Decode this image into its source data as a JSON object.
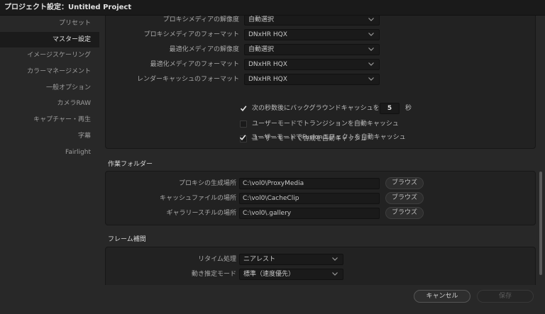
{
  "window": {
    "title": "プロジェクト設定：Untitled Project"
  },
  "sidebar": {
    "items": [
      {
        "label": "プリセット"
      },
      {
        "label": "マスター設定"
      },
      {
        "label": "イメージスケーリング"
      },
      {
        "label": "カラーマネージメント"
      },
      {
        "label": "一般オプション"
      },
      {
        "label": "カメラRAW"
      },
      {
        "label": "キャプチャー・再生"
      },
      {
        "label": "字幕"
      },
      {
        "label": "Fairlight"
      }
    ],
    "active_index": 1
  },
  "cache": {
    "rows": [
      {
        "label": "プロキシメディアの解像度",
        "value": "自動選択"
      },
      {
        "label": "プロキシメディアのフォーマット",
        "value": "DNxHR HQX"
      },
      {
        "label": "最適化メディアの解像度",
        "value": "自動選択"
      },
      {
        "label": "最適化メディアのフォーマット",
        "value": "DNxHR HQX"
      },
      {
        "label": "レンダーキャッシュのフォーマット",
        "value": "DNxHR HQX"
      }
    ],
    "bg_cache": {
      "label": "次の秒数後にバックグラウンドキャッシュを開始",
      "checked": true,
      "seconds": "5",
      "unit": "秒"
    },
    "options": [
      {
        "label": "ユーザーモードでトランジションを自動キャッシュ",
        "checked": false
      },
      {
        "label": "ユーザーモードで合成を自動キャッシュ",
        "checked": false
      },
      {
        "label": "ユーザーモードでFusionエフェクトを自動キャッシュ",
        "checked": true
      }
    ]
  },
  "working_folders": {
    "title": "作業フォルダー",
    "browse_label": "ブラウズ",
    "rows": [
      {
        "label": "プロキシの生成場所",
        "value": "C:\\vol0\\ProxyMedia"
      },
      {
        "label": "キャッシュファイルの場所",
        "value": "C:\\vol0\\CacheClip"
      },
      {
        "label": "ギャラリースチルの場所",
        "value": "C:\\vol0\\.gallery"
      }
    ]
  },
  "frame_interp": {
    "title": "フレーム補間",
    "rows": [
      {
        "label": "リタイム処理",
        "value": "ニアレスト"
      },
      {
        "label": "動き推定モード",
        "value": "標準（速度優先）"
      }
    ]
  },
  "footer": {
    "cancel_label": "キャンセル",
    "save_label": "保存"
  }
}
